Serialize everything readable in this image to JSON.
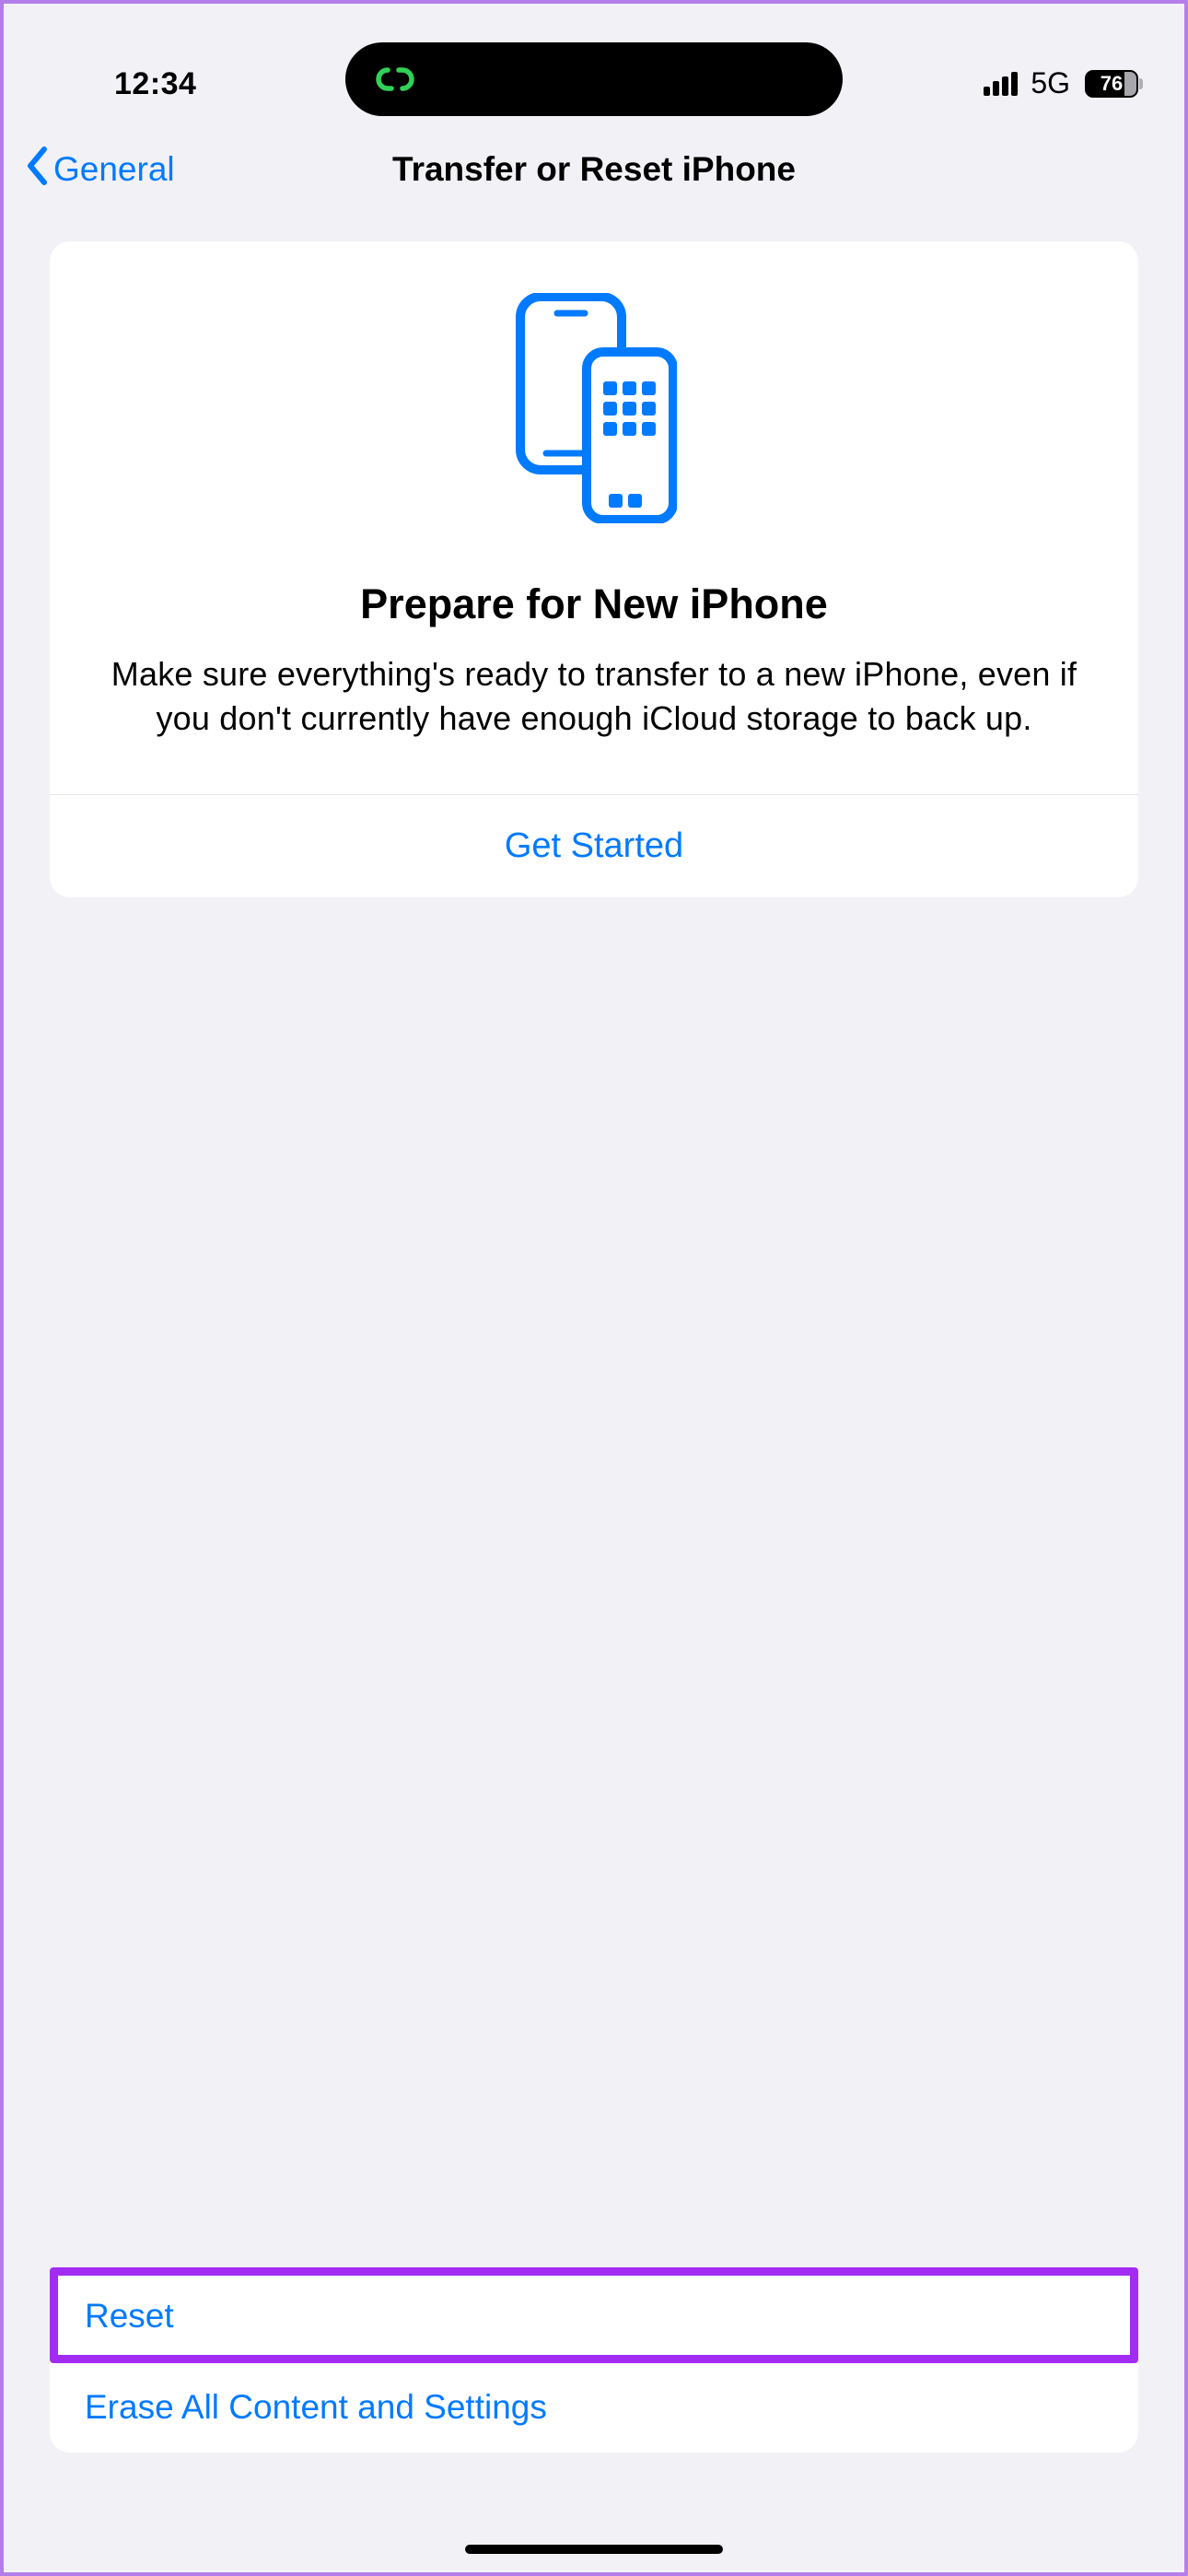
{
  "status": {
    "time": "12:34",
    "network": "5G",
    "battery": "76"
  },
  "nav": {
    "back": "General",
    "title": "Transfer or Reset iPhone"
  },
  "card": {
    "title": "Prepare for New iPhone",
    "description": "Make sure everything's ready to transfer to a new iPhone, even if you don't currently have enough iCloud storage to back up.",
    "cta": "Get Started"
  },
  "actions": {
    "reset": "Reset",
    "erase": "Erase All Content and Settings"
  }
}
